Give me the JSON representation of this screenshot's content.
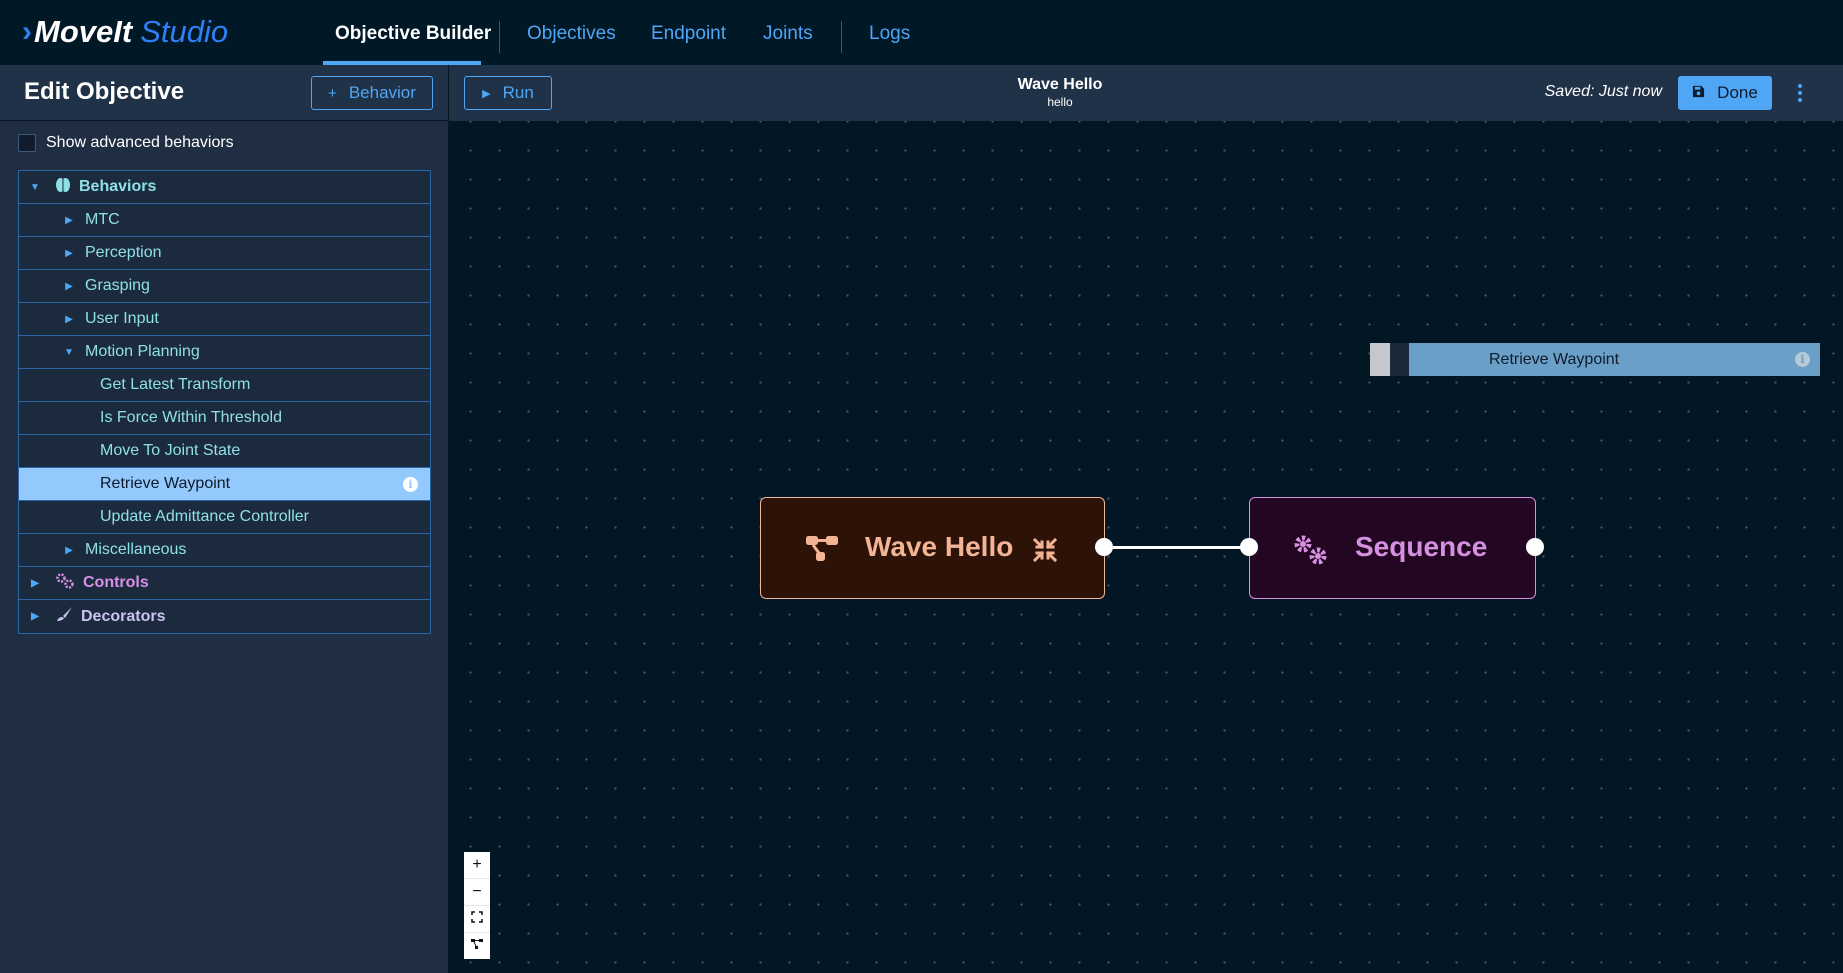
{
  "app": {
    "logo_prefix": "›",
    "logo_main": "MoveIt",
    "logo_suffix": "Studio"
  },
  "nav": {
    "tabs": [
      {
        "label": "Objective Builder",
        "active": true
      },
      {
        "label": "Objectives",
        "active": false
      },
      {
        "label": "Endpoint",
        "active": false
      },
      {
        "label": "Joints",
        "active": false
      },
      {
        "label": "Logs",
        "active": false
      }
    ]
  },
  "left": {
    "title": "Edit Objective",
    "add_behavior_label": "Behavior",
    "add_behavior_icon": "+",
    "show_advanced_label": "Show advanced behaviors",
    "show_advanced_checked": false,
    "tree": {
      "behaviors": {
        "label": "Behaviors",
        "icon": "brain-icon",
        "expanded": true
      },
      "groups": [
        {
          "label": "MTC",
          "expanded": false
        },
        {
          "label": "Perception",
          "expanded": false
        },
        {
          "label": "Grasping",
          "expanded": false
        },
        {
          "label": "User Input",
          "expanded": false
        },
        {
          "label": "Motion Planning",
          "expanded": true
        },
        {
          "label": "Miscellaneous",
          "expanded": false
        }
      ],
      "motion_planning_items": [
        {
          "label": "Get Latest Transform",
          "selected": false
        },
        {
          "label": "Is Force Within Threshold",
          "selected": false
        },
        {
          "label": "Move To Joint State",
          "selected": false
        },
        {
          "label": "Retrieve Waypoint",
          "selected": true
        },
        {
          "label": "Update Admittance Controller",
          "selected": false
        }
      ],
      "controls": {
        "label": "Controls",
        "icon": "gears-icon",
        "expanded": false
      },
      "decorators": {
        "label": "Decorators",
        "icon": "brush-icon",
        "expanded": false
      }
    }
  },
  "toolbar": {
    "run_label": "Run",
    "run_icon": "▶",
    "objective_name": "Wave Hello",
    "objective_description": "hello",
    "saved_status": "Saved: Just now",
    "done_label": "Done",
    "done_icon": "save-icon"
  },
  "canvas": {
    "nodes": [
      {
        "label": "Wave Hello",
        "type": "subtree",
        "color": "#f2b494"
      },
      {
        "label": "Sequence",
        "type": "control",
        "color": "#d690e0"
      }
    ],
    "drag_ghost_label": "Retrieve Waypoint",
    "zoom_controls": {
      "zoom_in": "+",
      "zoom_out": "−",
      "fit": "⛶",
      "layout": "tree"
    }
  },
  "colors": {
    "accent": "#4ea6f5",
    "nav_bg": "#011827",
    "panel_bg": "#1f2e42",
    "canvas_bg": "#021624",
    "selected_row": "#93c9fc"
  }
}
